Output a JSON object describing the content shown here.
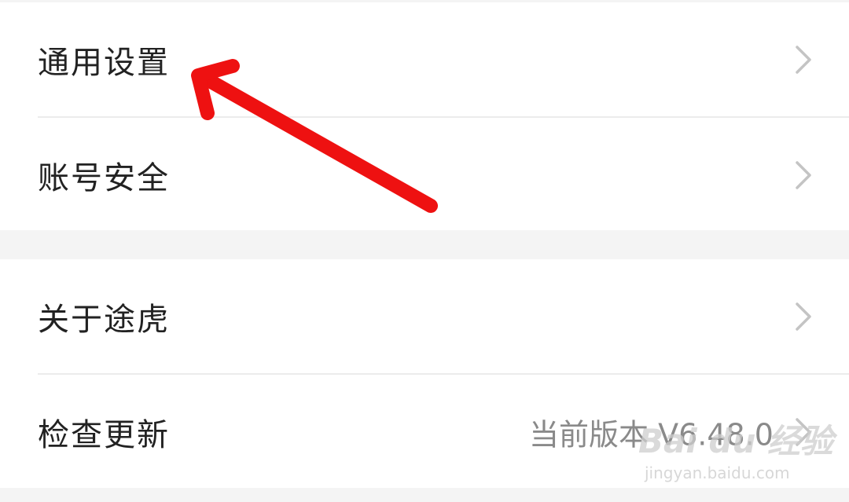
{
  "settings": {
    "group1": [
      {
        "label": "通用设置"
      },
      {
        "label": "账号安全"
      }
    ],
    "group2": [
      {
        "label": "关于途虎"
      },
      {
        "label": "检查更新",
        "value": "当前版本 V6.48.0"
      }
    ]
  },
  "icons": {
    "chevron": "chevron-right-icon",
    "annotation": "red-arrow"
  },
  "colors": {
    "annotation_red": "#ee1111",
    "chevron_gray": "#c4c4c4",
    "label_text": "#222222",
    "value_text": "#8a8a8a",
    "background": "#f4f4f4"
  },
  "watermark": {
    "main": "Bai du 经验",
    "sub": "jingyan.baidu.com"
  }
}
